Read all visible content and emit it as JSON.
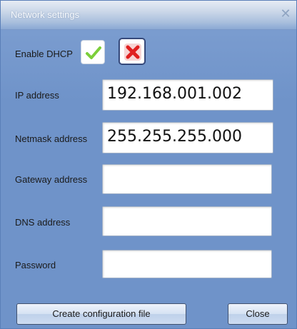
{
  "window": {
    "title": "Network settings",
    "close_glyph": "✕"
  },
  "dhcp": {
    "label": "Enable DHCP",
    "options": [
      {
        "icon": "check-icon",
        "state": "unselected"
      },
      {
        "icon": "x-icon",
        "state": "selected"
      }
    ],
    "colors": {
      "check": "#7ccf3a",
      "x": "#e02020"
    }
  },
  "fields": {
    "ip": {
      "label": "IP address",
      "value": "192.168.001.002"
    },
    "netmask": {
      "label": "Netmask address",
      "value": "255.255.255.000"
    },
    "gateway": {
      "label": "Gateway address",
      "value": ""
    },
    "dns": {
      "label": "DNS address",
      "value": ""
    },
    "password": {
      "label": "Password",
      "value": ""
    }
  },
  "buttons": {
    "create": "Create configuration file",
    "close": "Close"
  }
}
